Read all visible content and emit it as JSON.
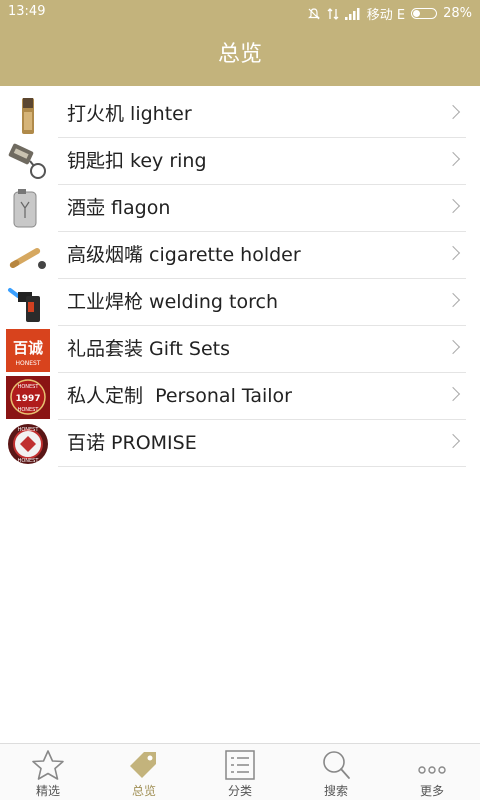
{
  "status_bar": {
    "time": "13:49",
    "carrier": "移动 E",
    "battery": "28%",
    "battery_level": 0.28
  },
  "header": {
    "title": "总览"
  },
  "list": {
    "items": [
      {
        "label": "打火机 lighter",
        "icon": "lighter-thumbnail"
      },
      {
        "label": "钥匙扣 key ring",
        "icon": "key-ring-thumbnail"
      },
      {
        "label": "酒壶 flagon",
        "icon": "flagon-thumbnail"
      },
      {
        "label": "高级烟嘴 cigarette holder",
        "icon": "cigarette-holder-thumbnail"
      },
      {
        "label": "工业焊枪 welding torch",
        "icon": "welding-torch-thumbnail"
      },
      {
        "label": "礼品套装 Gift Sets",
        "icon": "gift-sets-logo",
        "logo_text": "百诚",
        "logo_subtext": "HONEST"
      },
      {
        "label": "私人定制  Personal Tailor",
        "icon": "personal-tailor-badge",
        "logo_text": "1997",
        "logo_subtext": "HONEST"
      },
      {
        "label": "百诺 PROMISE",
        "icon": "promise-badge",
        "logo_subtext": "HONEST"
      }
    ]
  },
  "tab_bar": {
    "tabs": [
      {
        "label": "精选",
        "icon": "star-icon"
      },
      {
        "label": "总览",
        "icon": "tag-icon",
        "active": true
      },
      {
        "label": "分类",
        "icon": "list-icon"
      },
      {
        "label": "搜索",
        "icon": "search-icon"
      },
      {
        "label": "更多",
        "icon": "more-icon"
      }
    ]
  },
  "colors": {
    "accent": "#c3b37c",
    "active_tab": "#a08f55",
    "inactive_tab": "#555555"
  }
}
